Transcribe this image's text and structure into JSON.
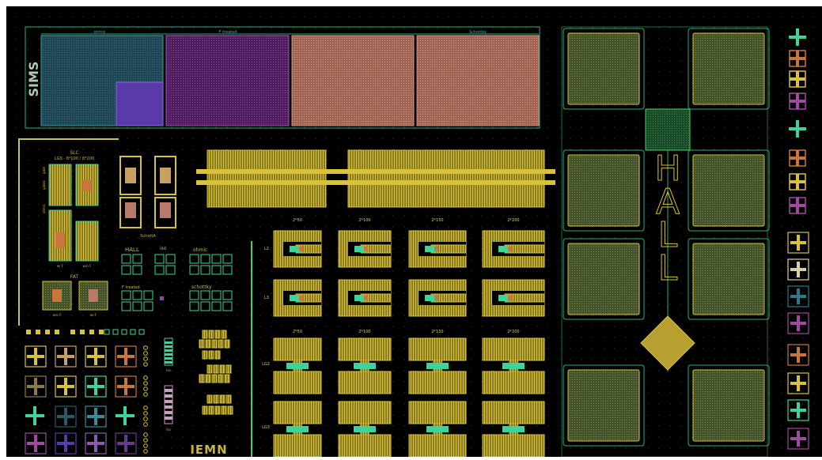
{
  "colors": {
    "background": "#000000",
    "frame": "#ffffff",
    "outline": "#2ab072",
    "pad_fill": "#5a6a3a",
    "pad_border": "#3fd39a",
    "yellow": "#d8c23a",
    "orange": "#c8763a",
    "salmon": "#b97a6a",
    "purple": "#6a2a7a",
    "teal": "#2a5a6a",
    "violet": "#5a3aa8",
    "green": "#3fd35a",
    "label": "#c8b440",
    "label_green": "#7fdcc0"
  },
  "sims": {
    "label": "SIMS",
    "region_labels": [
      "ohmic",
      "F treated",
      "Schottky"
    ]
  },
  "slc": {
    "title": "SLC",
    "subtitle": "LGS - 8*100 / 8*200",
    "side_labels": [
      "ohmic",
      "gated",
      "gate"
    ],
    "foot_labels": [
      "w/ F",
      "w/o F"
    ]
  },
  "fat": {
    "title": "FAT",
    "foot_labels": [
      "w/o F",
      "w/ F"
    ]
  },
  "schottky_label": "SchottA",
  "hall_small": {
    "hall": "HALL",
    "iso": "iso",
    "ohmic": "ohmic",
    "f_treated": "F treated",
    "schottky": "schottky"
  },
  "column_headers_top": [
    "2*50",
    "2*100",
    "2*150",
    "2*200"
  ],
  "column_headers_bottom": [
    "2*50",
    "2*100",
    "2*150",
    "2*200"
  ],
  "row_labels_top": [
    "L2",
    "L3"
  ],
  "row_labels_bottom": [
    "LG2",
    "LG3"
  ],
  "tlm_labels": [
    "Iso",
    "Iso"
  ],
  "hall_big": [
    "H",
    "A",
    "L",
    "L"
  ],
  "logo": "IEMN"
}
